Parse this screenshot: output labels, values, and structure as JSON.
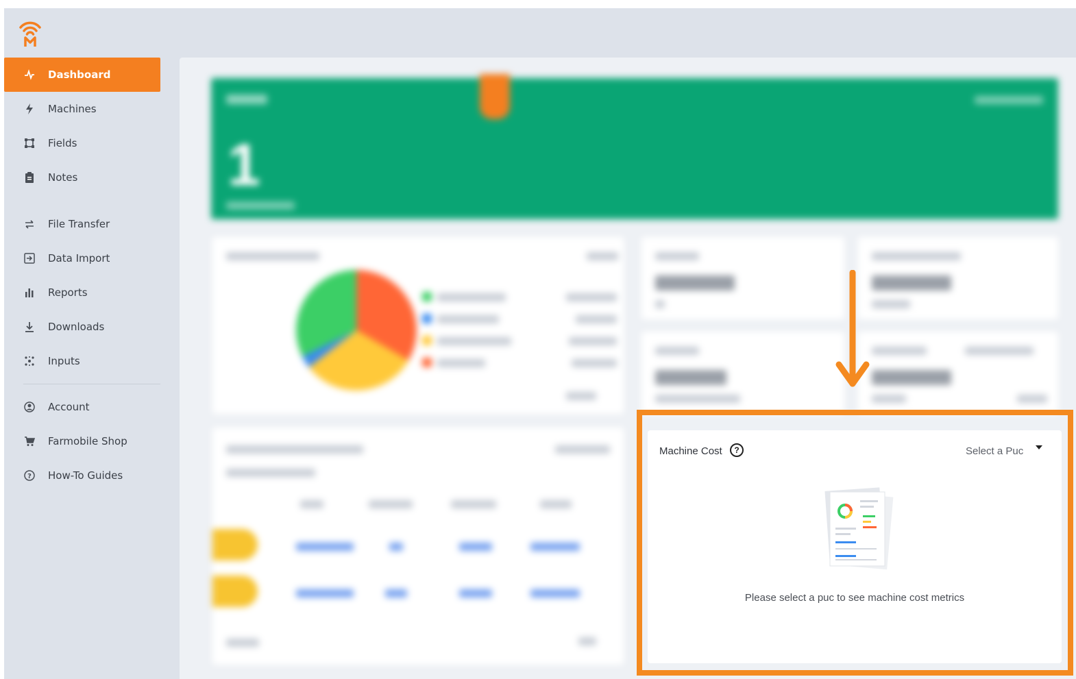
{
  "sidebar": {
    "items": [
      {
        "label": "Dashboard",
        "icon": "activity-icon",
        "active": true
      },
      {
        "label": "Machines",
        "icon": "bolt-icon"
      },
      {
        "label": "Fields",
        "icon": "field-icon"
      },
      {
        "label": "Notes",
        "icon": "clipboard-icon"
      },
      {
        "label": "File Transfer",
        "icon": "transfer-icon"
      },
      {
        "label": "Data Import",
        "icon": "import-icon"
      },
      {
        "label": "Reports",
        "icon": "bar-chart-icon"
      },
      {
        "label": "Downloads",
        "icon": "download-icon"
      },
      {
        "label": "Inputs",
        "icon": "inputs-icon"
      },
      {
        "label": "Account",
        "icon": "account-icon"
      },
      {
        "label": "Farmobile Shop",
        "icon": "cart-icon"
      },
      {
        "label": "How-To Guides",
        "icon": "help-icon"
      }
    ]
  },
  "banner": {
    "value": "1",
    "color": "#0aa574"
  },
  "machine_cost": {
    "title": "Machine Cost",
    "select_placeholder": "Select a Puc",
    "empty_message": "Please select a puc to see machine cost metrics"
  },
  "colors": {
    "accent": "#f47f20",
    "highlight": "#f48a20",
    "sidebar_bg": "#dde2ea"
  }
}
